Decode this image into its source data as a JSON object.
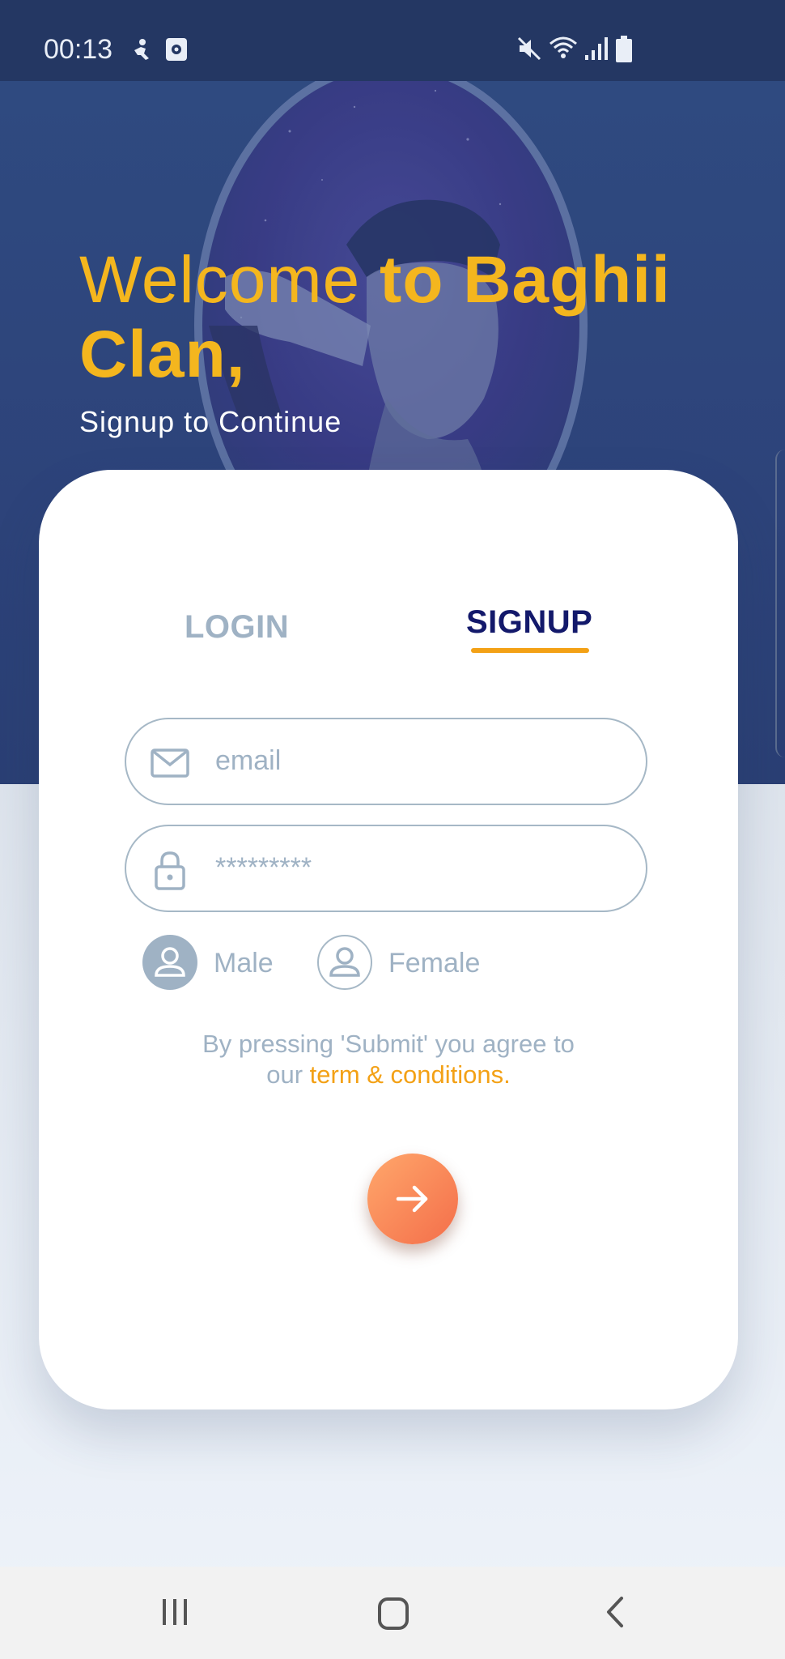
{
  "status_bar": {
    "time": "00:13",
    "left_icons": [
      "accessibility-icon",
      "screen-record-icon"
    ],
    "right_icons": [
      "mute-icon",
      "wifi-icon",
      "signal-icon",
      "battery-icon"
    ]
  },
  "hero": {
    "title_part1": "Welcome",
    "title_part2": " to Baghii Clan,",
    "subtitle": "Signup to Continue",
    "accent_color": "#f4b61e"
  },
  "tabs": {
    "login": "LOGIN",
    "signup": "SIGNUP",
    "active": "signup",
    "active_underline_color": "#f3a116"
  },
  "form": {
    "email_placeholder": "email",
    "password_value": "*********",
    "gender": {
      "male_label": "Male",
      "female_label": "Female",
      "selected": "male"
    },
    "terms_text": "By pressing 'Submit' you agree to our ",
    "terms_link": "term & conditions."
  },
  "submit": {
    "icon": "arrow-right-icon"
  },
  "nav_bar": {
    "icons": [
      "recent-apps-icon",
      "home-icon",
      "back-icon"
    ]
  }
}
